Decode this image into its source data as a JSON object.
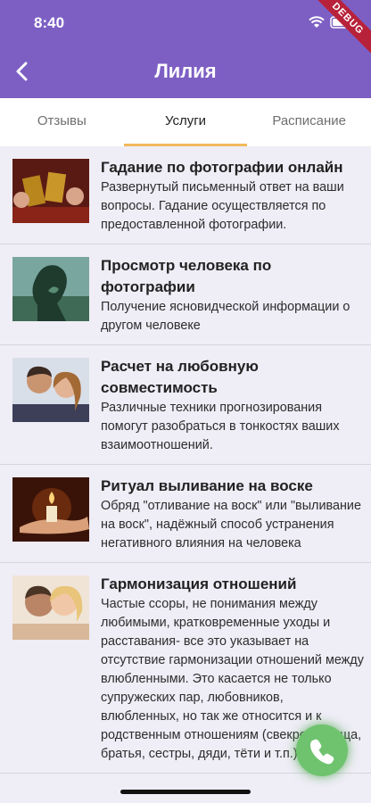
{
  "status": {
    "time": "8:40",
    "debug_label": "DEBUG"
  },
  "header": {
    "title": "Лилия",
    "back_icon": "chevron-left-icon"
  },
  "tabs": [
    {
      "label": "Отзывы",
      "active": false
    },
    {
      "label": "Услуги",
      "active": true
    },
    {
      "label": "Расписание",
      "active": false
    }
  ],
  "services": [
    {
      "title": "Гадание по фотографии онлайн",
      "description": "Развернутый письменный ответ на ваши вопросы. Гадание осуществляется по предоставленной фотографии."
    },
    {
      "title": "Просмотр человека по фотографии",
      "description": "Получение ясновидческой информации о другом человеке"
    },
    {
      "title": "Расчет на любовную совместимость",
      "description": "Различные техники прогнозирования помогут разобраться в тонкостях ваших взаимоотношений."
    },
    {
      "title": "Ритуал выливание на воске",
      "description": "Обряд \"отливание на воск\" или \"выливание на воск\", надёжный способ устранения негативного влияния на человека"
    },
    {
      "title": "Гармонизация отношений",
      "description": "Частые ссоры, не понимания между любимыми, кратковременные уходы и расставания- все это указывает на отсутствие гармонизации отношений между влюбленными. Это касается не только супружеских пар, любовников, влюбленных, но так же относится и к родственным отношениям (свекровь, теща, братья, сестры, дяди, тёти и т.п.)"
    }
  ],
  "fab": {
    "icon": "phone-icon"
  },
  "colors": {
    "appbar": "#7d5fc4",
    "tab_indicator": "#f2b95c",
    "fab": "#6fc36f",
    "background": "#efedf6"
  }
}
